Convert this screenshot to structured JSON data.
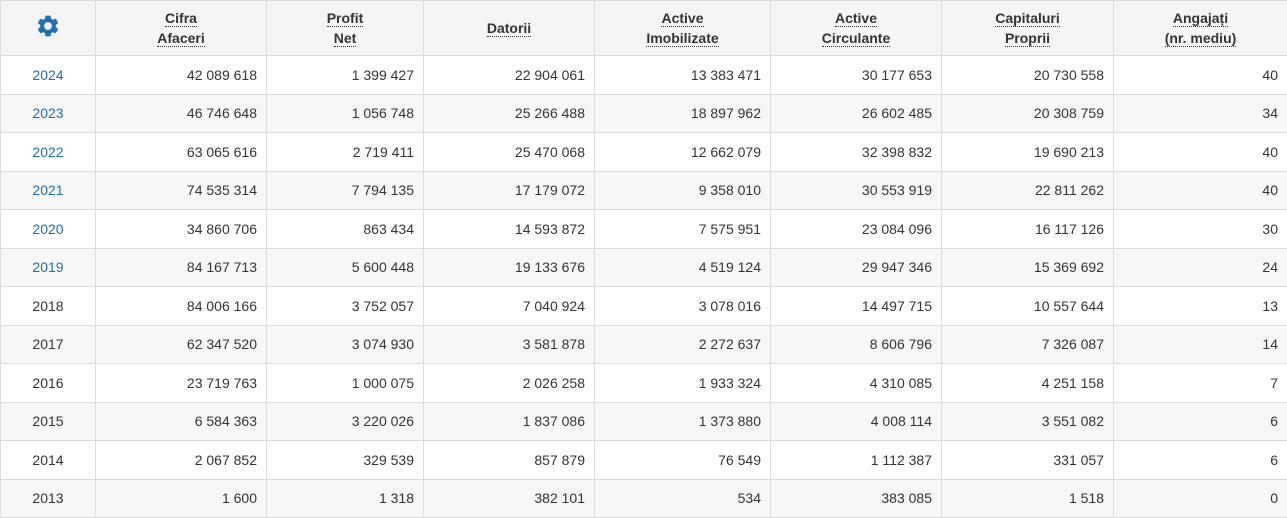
{
  "settings_icon_color": "#1f6fb2",
  "link_color": "#1f6fb2",
  "headers": [
    {
      "line1": "Cifra",
      "line2": "Afaceri"
    },
    {
      "line1": "Profit",
      "line2": "Net"
    },
    {
      "line1": "Datorii",
      "line2": ""
    },
    {
      "line1": "Active",
      "line2": "Imobilizate"
    },
    {
      "line1": "Active",
      "line2": "Circulante"
    },
    {
      "line1": "Capitaluri",
      "line2": "Proprii"
    },
    {
      "line1": "Angajați",
      "line2": "(nr. mediu)"
    }
  ],
  "rows": [
    {
      "year": "2024",
      "link": true,
      "values": [
        "42 089 618",
        "1 399 427",
        "22 904 061",
        "13 383 471",
        "30 177 653",
        "20 730 558",
        "40"
      ]
    },
    {
      "year": "2023",
      "link": true,
      "values": [
        "46 746 648",
        "1 056 748",
        "25 266 488",
        "18 897 962",
        "26 602 485",
        "20 308 759",
        "34"
      ]
    },
    {
      "year": "2022",
      "link": true,
      "values": [
        "63 065 616",
        "2 719 411",
        "25 470 068",
        "12 662 079",
        "32 398 832",
        "19 690 213",
        "40"
      ]
    },
    {
      "year": "2021",
      "link": true,
      "values": [
        "74 535 314",
        "7 794 135",
        "17 179 072",
        "9 358 010",
        "30 553 919",
        "22 811 262",
        "40"
      ]
    },
    {
      "year": "2020",
      "link": true,
      "values": [
        "34 860 706",
        "863 434",
        "14 593 872",
        "7 575 951",
        "23 084 096",
        "16 117 126",
        "30"
      ]
    },
    {
      "year": "2019",
      "link": true,
      "values": [
        "84 167 713",
        "5 600 448",
        "19 133 676",
        "4 519 124",
        "29 947 346",
        "15 369 692",
        "24"
      ]
    },
    {
      "year": "2018",
      "link": false,
      "values": [
        "84 006 166",
        "3 752 057",
        "7 040 924",
        "3 078 016",
        "14 497 715",
        "10 557 644",
        "13"
      ]
    },
    {
      "year": "2017",
      "link": false,
      "values": [
        "62 347 520",
        "3 074 930",
        "3 581 878",
        "2 272 637",
        "8 606 796",
        "7 326 087",
        "14"
      ]
    },
    {
      "year": "2016",
      "link": false,
      "values": [
        "23 719 763",
        "1 000 075",
        "2 026 258",
        "1 933 324",
        "4 310 085",
        "4 251 158",
        "7"
      ]
    },
    {
      "year": "2015",
      "link": false,
      "values": [
        "6 584 363",
        "3 220 026",
        "1 837 086",
        "1 373 880",
        "4 008 114",
        "3 551 082",
        "6"
      ]
    },
    {
      "year": "2014",
      "link": false,
      "values": [
        "2 067 852",
        "329 539",
        "857 879",
        "76 549",
        "1 112 387",
        "331 057",
        "6"
      ]
    },
    {
      "year": "2013",
      "link": false,
      "values": [
        "1 600",
        "1 318",
        "382 101",
        "534",
        "383 085",
        "1 518",
        "0"
      ]
    }
  ]
}
